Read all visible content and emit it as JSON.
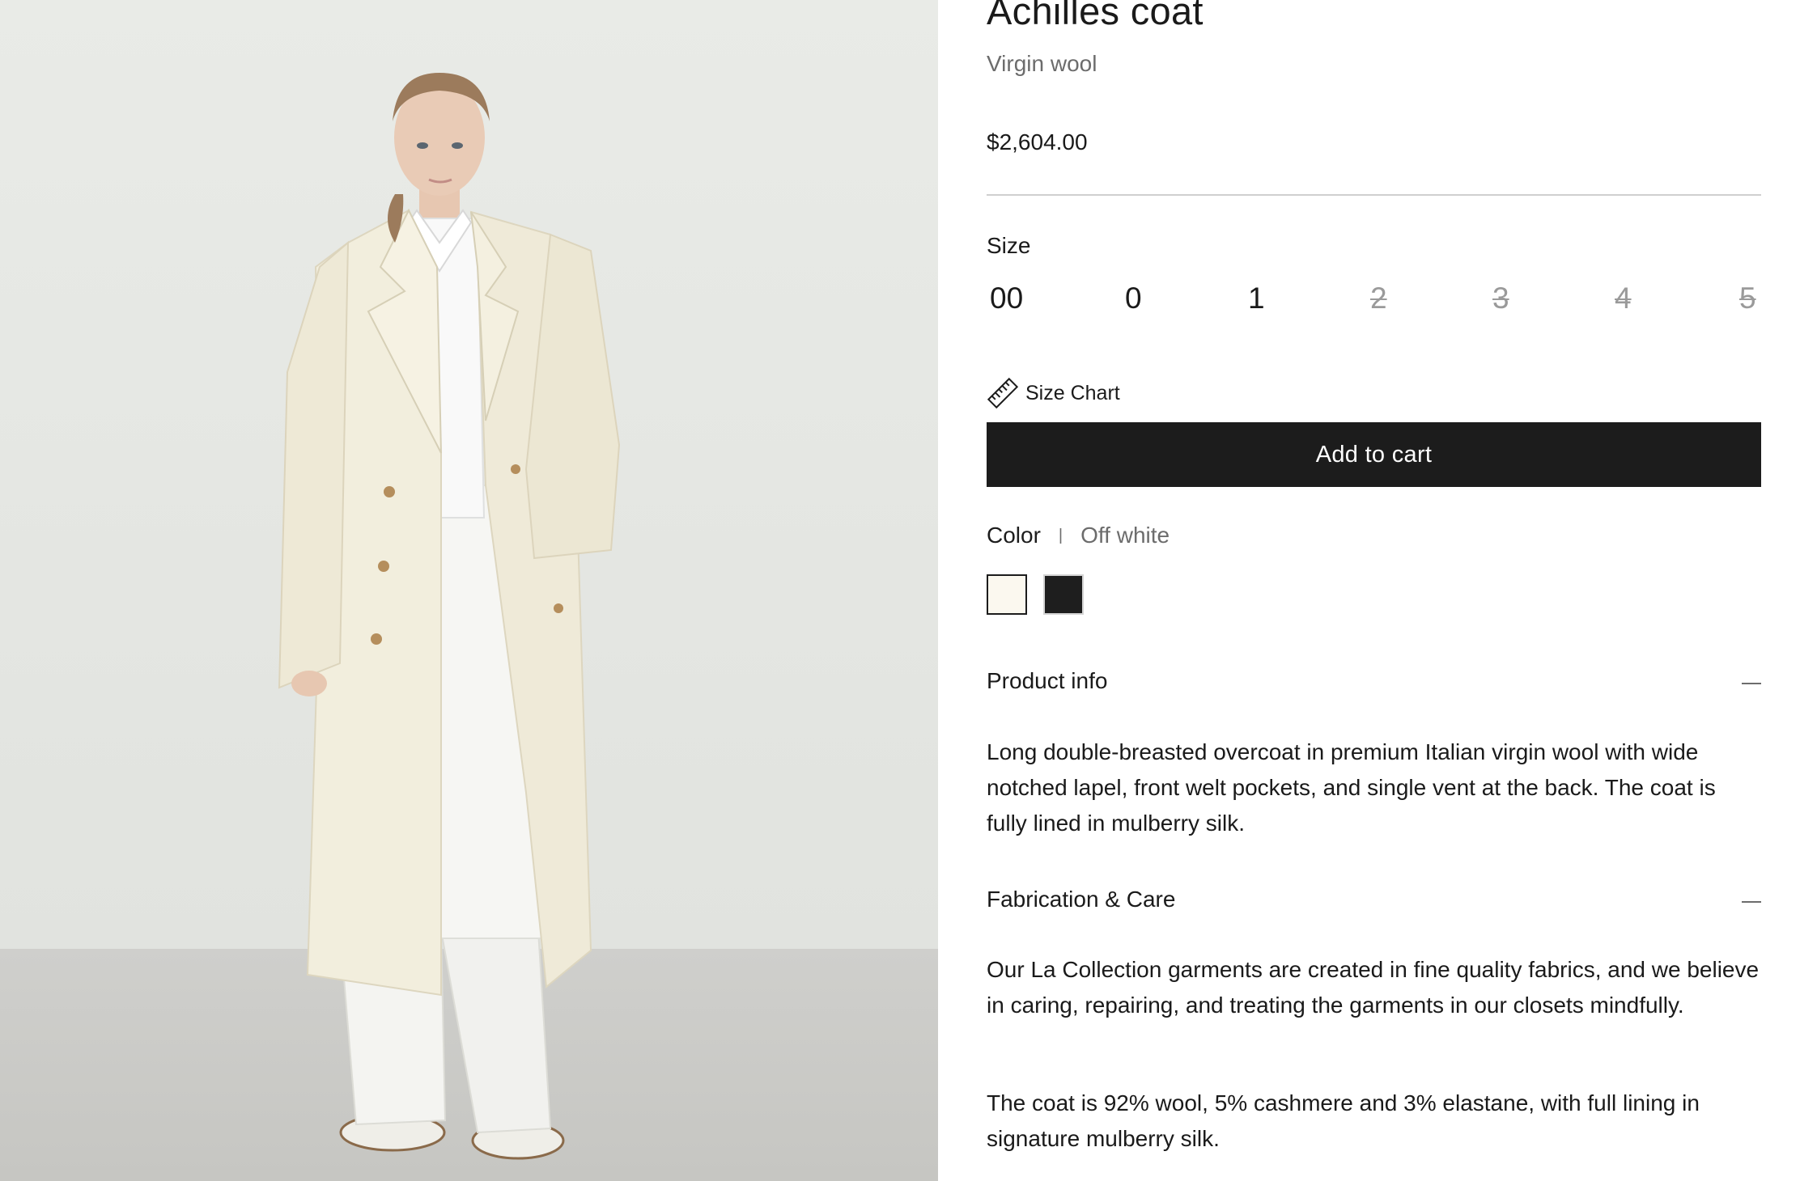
{
  "product": {
    "title": "Achilles coat",
    "subtitle": "Virgin wool",
    "price": "$2,604.00",
    "image_alt": "Model wearing off-white long double-breasted coat"
  },
  "size": {
    "label": "Size",
    "options": [
      {
        "label": "00",
        "available": true
      },
      {
        "label": "0",
        "available": true
      },
      {
        "label": "1",
        "available": true
      },
      {
        "label": "2",
        "available": false
      },
      {
        "label": "3",
        "available": false
      },
      {
        "label": "4",
        "available": false
      },
      {
        "label": "5",
        "available": false
      }
    ],
    "chart_label": "Size Chart",
    "chart_icon": "ruler-icon"
  },
  "cart": {
    "button_label": "Add to cart"
  },
  "color": {
    "label": "Color",
    "separator": "|",
    "selected": "Off white",
    "swatches": [
      {
        "name": "Off white",
        "hex": "#fbf8ef",
        "selected": true
      },
      {
        "name": "Black",
        "hex": "#1e1e1e",
        "selected": false
      }
    ]
  },
  "accordions": {
    "product_info": {
      "title": "Product info",
      "body": "Long double-breasted overcoat in premium Italian virgin wool with wide notched lapel, front welt pockets, and single vent at the back. The coat is fully lined in mulberry silk."
    },
    "fabrication": {
      "title": "Fabrication & Care",
      "body": "Our La Collection garments are created in fine quality fabrics, and we believe in caring, repairing, and treating the garments in our closets mindfully.",
      "body2": "The coat is 92% wool, 5% cashmere and 3% elastane, with full lining in signature mulberry silk."
    }
  },
  "colors": {
    "button_bg": "#1c1c1c",
    "muted_text": "#6c6c6c",
    "disabled_text": "#9a9a9a",
    "coat": "#f2eedd"
  }
}
